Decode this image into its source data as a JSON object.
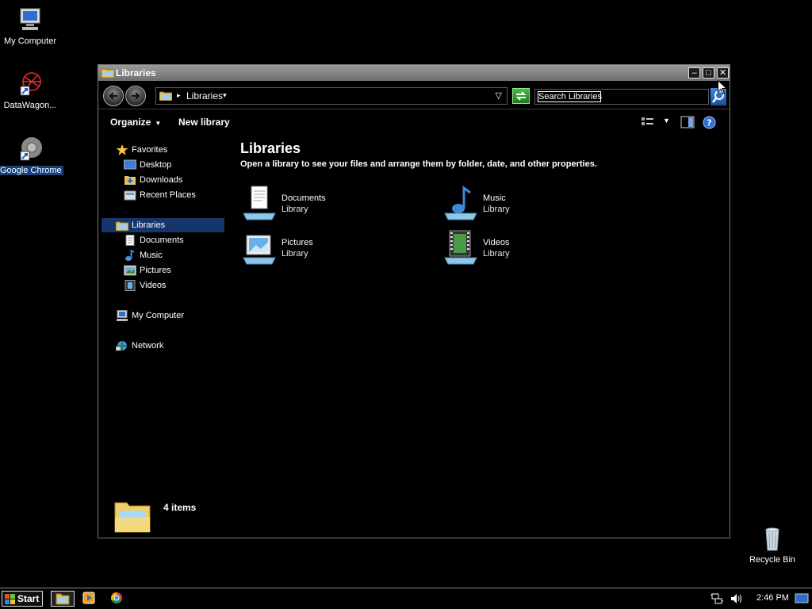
{
  "desktop": {
    "icons": [
      {
        "label": "My Computer"
      },
      {
        "label": "DataWagon..."
      },
      {
        "label": "Google Chrome"
      },
      {
        "label": "Recycle Bin"
      }
    ]
  },
  "window": {
    "title": "Libraries",
    "controls": {
      "minimize": "–",
      "maximize": "□",
      "close": "✕"
    },
    "address": {
      "crumb": "Libraries",
      "arrow": "▸",
      "dropdown": "▽"
    },
    "search": {
      "placeholder": "Search Libraries"
    },
    "toolbar": {
      "organize": "Organize",
      "new_library": "New library",
      "caret": "▼"
    },
    "nav": {
      "favorites": "Favorites",
      "favorites_items": [
        "Desktop",
        "Downloads",
        "Recent Places"
      ],
      "libraries": "Libraries",
      "libraries_items": [
        "Documents",
        "Music",
        "Pictures",
        "Videos"
      ],
      "computer": "My Computer",
      "network": "Network"
    },
    "content": {
      "title": "Libraries",
      "subtitle": "Open a library to see your files and arrange them by folder, date, and other properties.",
      "libraries": [
        {
          "name": "Documents",
          "type": "Library",
          "icon": "documents-library-icon"
        },
        {
          "name": "Music",
          "type": "Library",
          "icon": "music-library-icon"
        },
        {
          "name": "Pictures",
          "type": "Library",
          "icon": "pictures-library-icon"
        },
        {
          "name": "Videos",
          "type": "Library",
          "icon": "videos-library-icon"
        }
      ]
    },
    "details": {
      "count": "4 items"
    }
  },
  "taskbar": {
    "start_label": "Start",
    "clock": "2:46 PM"
  },
  "colors": {
    "background": "#000000",
    "selection": "#16356b",
    "titlebar": "#8a8a8a"
  }
}
